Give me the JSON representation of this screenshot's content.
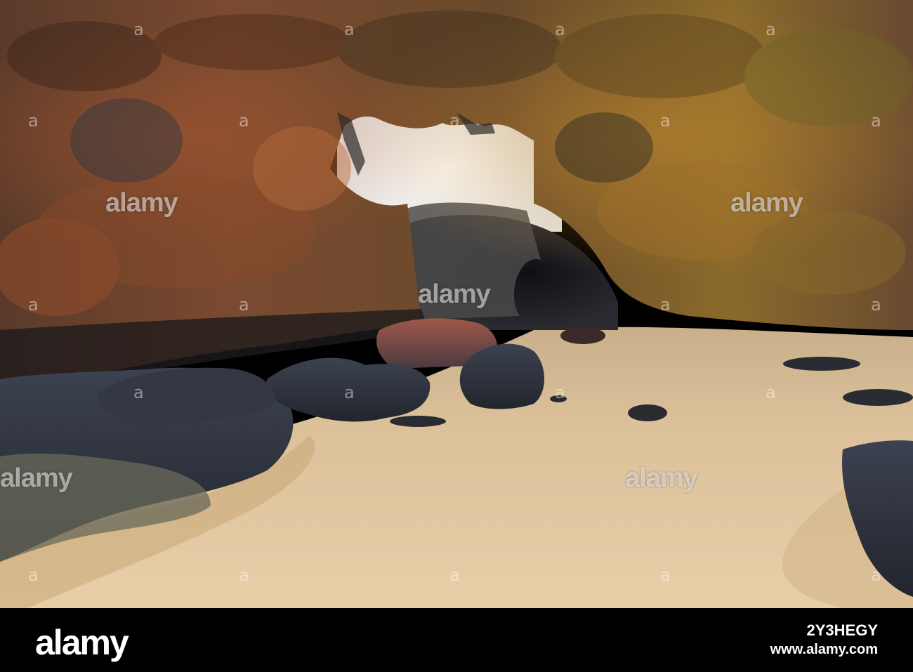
{
  "photo": {
    "scene": "sea-cave-skylight-beach",
    "colors": {
      "sky": "#eef0f2",
      "sand": "#d9bc95",
      "rock_warm": "#8a4a2c",
      "rock_dark": "#2d3038",
      "rock_moss": "#8f8a3a"
    }
  },
  "watermark": {
    "text": "alamy",
    "mark_glyph": "a"
  },
  "footer": {
    "logo": "alamy",
    "image_id": "2Y3HEGY",
    "url": "www.alamy.com"
  }
}
